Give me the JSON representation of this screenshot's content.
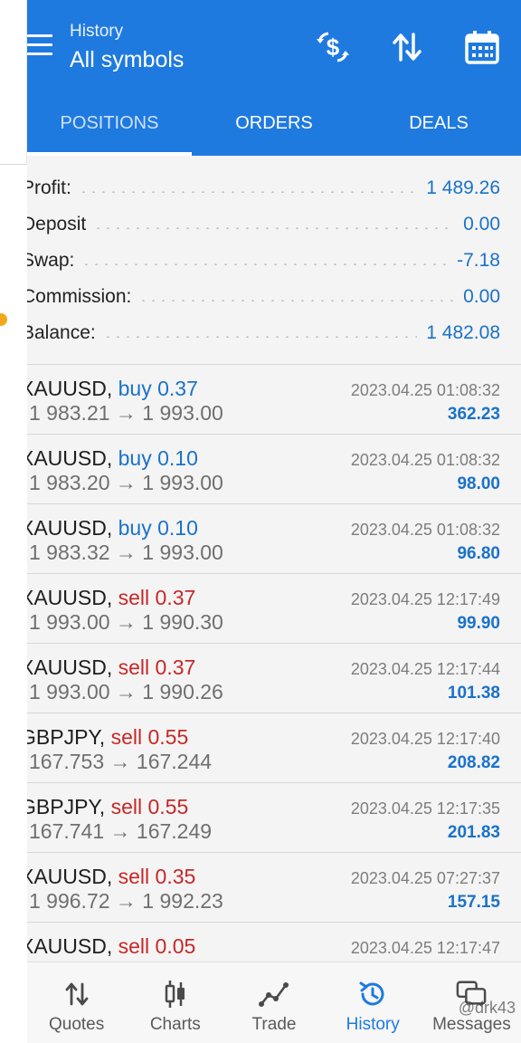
{
  "header": {
    "subtitle": "History",
    "title": "All symbols"
  },
  "header_icons": [
    "currency-exchange-icon",
    "sort-icon",
    "calendar-icon"
  ],
  "tabs": [
    {
      "label": "POSITIONS",
      "active": true
    },
    {
      "label": "ORDERS",
      "active": false
    },
    {
      "label": "DEALS",
      "active": false
    }
  ],
  "summary": [
    {
      "label": "Profit:",
      "value": "1 489.26"
    },
    {
      "label": "Deposit",
      "value": "0.00"
    },
    {
      "label": "Swap:",
      "value": "-7.18"
    },
    {
      "label": "Commission:",
      "value": "0.00"
    },
    {
      "label": "Balance:",
      "value": "1 482.08"
    }
  ],
  "deals": [
    {
      "symbol": "XAUUSD,",
      "side": "buy",
      "side_text": "buy 0.37",
      "prices": "1 983.21 → 1 993.00",
      "time": "2023.04.25 01:08:32",
      "profit": "362.23"
    },
    {
      "symbol": "XAUUSD,",
      "side": "buy",
      "side_text": "buy 0.10",
      "prices": "1 983.20 → 1 993.00",
      "time": "2023.04.25 01:08:32",
      "profit": "98.00"
    },
    {
      "symbol": "XAUUSD,",
      "side": "buy",
      "side_text": "buy 0.10",
      "prices": "1 983.32 → 1 993.00",
      "time": "2023.04.25 01:08:32",
      "profit": "96.80"
    },
    {
      "symbol": "XAUUSD,",
      "side": "sell",
      "side_text": "sell 0.37",
      "prices": "1 993.00 → 1 990.30",
      "time": "2023.04.25 12:17:49",
      "profit": "99.90"
    },
    {
      "symbol": "XAUUSD,",
      "side": "sell",
      "side_text": "sell 0.37",
      "prices": "1 993.00 → 1 990.26",
      "time": "2023.04.25 12:17:44",
      "profit": "101.38"
    },
    {
      "symbol": "GBPJPY,",
      "side": "sell",
      "side_text": "sell 0.55",
      "prices": "167.753 → 167.244",
      "time": "2023.04.25 12:17:40",
      "profit": "208.82"
    },
    {
      "symbol": "GBPJPY,",
      "side": "sell",
      "side_text": "sell 0.55",
      "prices": "167.741 → 167.249",
      "time": "2023.04.25 12:17:35",
      "profit": "201.83"
    },
    {
      "symbol": "XAUUSD,",
      "side": "sell",
      "side_text": "sell 0.35",
      "prices": "1 996.72 → 1 992.23",
      "time": "2023.04.25 07:27:37",
      "profit": "157.15"
    },
    {
      "symbol": "XAUUSD,",
      "side": "sell",
      "side_text": "sell 0.05",
      "prices": "",
      "time": "2023.04.25 12:17:47",
      "profit": ""
    }
  ],
  "bottom_nav": [
    {
      "label": "Quotes",
      "icon": "sort-arrows-icon",
      "active": false
    },
    {
      "label": "Charts",
      "icon": "candlestick-icon",
      "active": false
    },
    {
      "label": "Trade",
      "icon": "trend-line-icon",
      "active": false
    },
    {
      "label": "History",
      "icon": "history-clock-icon",
      "active": true
    },
    {
      "label": "Messages",
      "icon": "chat-bubbles-icon",
      "active": false
    }
  ],
  "watermark": "@drk43",
  "colors": {
    "header": "#1f7ae0",
    "buy": "#1a72c9",
    "sell": "#c62828",
    "value": "#1a72c9"
  }
}
